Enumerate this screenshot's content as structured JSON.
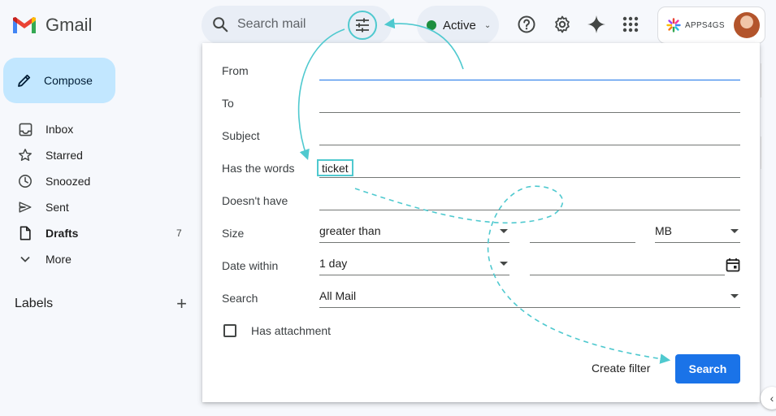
{
  "app": {
    "name": "Gmail"
  },
  "search": {
    "placeholder": "Search mail"
  },
  "status": {
    "label": "Active",
    "color": "#1e8e3e"
  },
  "account": {
    "brand": "APPS4GS"
  },
  "sidebar": {
    "compose_label": "Compose",
    "items": [
      {
        "label": "Inbox",
        "icon": "inbox-icon"
      },
      {
        "label": "Starred",
        "icon": "star-icon"
      },
      {
        "label": "Snoozed",
        "icon": "clock-icon"
      },
      {
        "label": "Sent",
        "icon": "send-icon"
      },
      {
        "label": "Drafts",
        "icon": "file-icon",
        "count": "7"
      },
      {
        "label": "More",
        "icon": "chevron-down-icon"
      }
    ],
    "labels_heading": "Labels"
  },
  "advanced_search": {
    "from_label": "From",
    "to_label": "To",
    "subject_label": "Subject",
    "has_words_label": "Has the words",
    "has_words_value": "ticket",
    "doesnt_have_label": "Doesn't have",
    "size_label": "Size",
    "size_operator": "greater than",
    "size_unit": "MB",
    "date_label": "Date within",
    "date_value": "1 day",
    "search_label": "Search",
    "search_scope": "All Mail",
    "attachment_label": "Has attachment",
    "create_filter_label": "Create filter",
    "search_button_label": "Search"
  },
  "colors": {
    "accent": "#1a73e8",
    "compose_bg": "#c2e7ff",
    "annotation": "#4fc9cf",
    "page_bg": "#f6f8fc"
  }
}
